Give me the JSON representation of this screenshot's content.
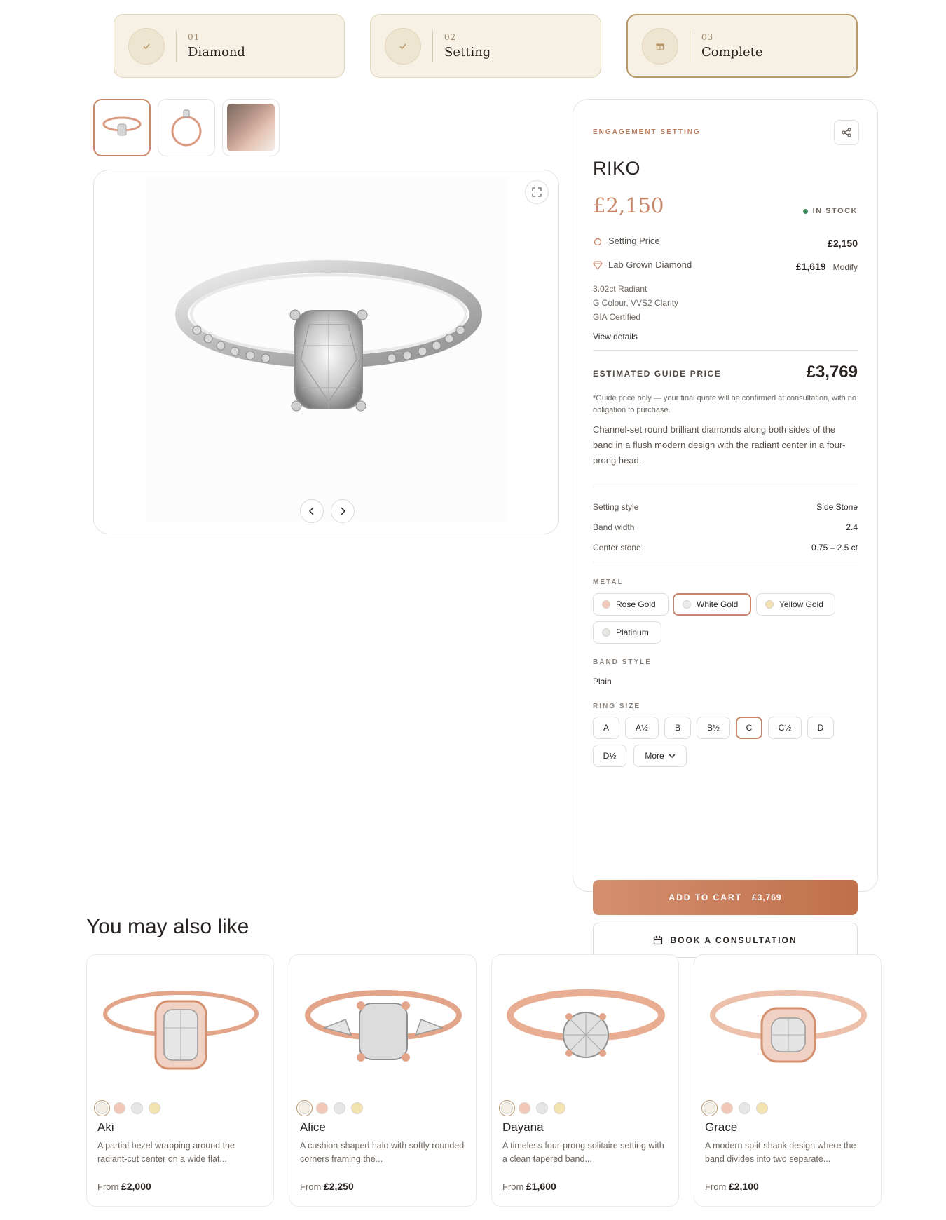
{
  "steps": [
    {
      "num": "01",
      "label": "Diamond",
      "state": "done"
    },
    {
      "num": "02",
      "label": "Setting",
      "state": "done"
    },
    {
      "num": "03",
      "label": "Complete",
      "state": "active"
    }
  ],
  "product": {
    "eyebrow": "ENGAGEMENT SETTING",
    "name": "RIKO",
    "price": "£2,150",
    "stock": "IN STOCK",
    "setting_price_label": "Setting Price",
    "setting_price": "£2,150",
    "diamond_label": "Lab Grown Diamond",
    "diamond_price": "£1,619",
    "modify": "Modify",
    "diamond_details": [
      "3.02ct Radiant",
      "G Colour, VVS2 Clarity",
      "GIA Certified"
    ],
    "view_details": "View details",
    "estimate_label": "ESTIMATED GUIDE PRICE",
    "estimate": "£3,769",
    "note": "*Guide price only — your final quote will be confirmed at consultation, with no obligation to purchase.",
    "description": "Channel-set round brilliant diamonds along both sides of the band in a flush modern design with the radiant center in a four-prong head.",
    "specs": [
      {
        "label": "Setting style",
        "value": "Side Stone"
      },
      {
        "label": "Band width",
        "value": "2.4"
      },
      {
        "label": "Center stone",
        "value": "0.75 – 2.5 ct"
      }
    ],
    "metal_label": "METAL",
    "metals": [
      {
        "label": "Rose Gold",
        "color": "#f2c9b8"
      },
      {
        "label": "White Gold",
        "color": "#e8e8e8"
      },
      {
        "label": "Yellow Gold",
        "color": "#f3e3b0"
      },
      {
        "label": "Platinum",
        "color": "#e5e5e5"
      }
    ],
    "selected_metal": "White Gold",
    "band_label": "BAND STYLE",
    "band_value": "Plain",
    "size_label": "RING SIZE",
    "sizes": [
      "A",
      "A½",
      "B",
      "B½",
      "C",
      "C½",
      "D",
      "D½"
    ],
    "selected_size": "C",
    "more": "More",
    "cart_label": "ADD TO CART",
    "cart_price": "£3,769",
    "consult_label": "BOOK A CONSULTATION"
  },
  "recommendations": {
    "title": "You may also like",
    "items": [
      {
        "name": "Aki",
        "desc": "A partial bezel wrapping around the radiant-cut center on a wide flat...",
        "from": "From",
        "price": "£2,000"
      },
      {
        "name": "Alice",
        "desc": "A cushion-shaped halo with softly rounded corners framing the...",
        "from": "From",
        "price": "£2,250"
      },
      {
        "name": "Dayana",
        "desc": "A timeless four-prong solitaire setting with a clean tapered band...",
        "from": "From",
        "price": "£1,600"
      },
      {
        "name": "Grace",
        "desc": "A modern split-shank design where the band divides into two separate...",
        "from": "From",
        "price": "£2,100"
      }
    ],
    "swatch_colors": [
      "#f4efe6",
      "#f2c9b8",
      "#e6e6e6",
      "#f3e3b0"
    ]
  },
  "colors": {
    "accent": "#c6866a",
    "gold_border": "#b8976a",
    "step_bg": "#f6f1e4",
    "in_stock": "#3c8a5c"
  }
}
